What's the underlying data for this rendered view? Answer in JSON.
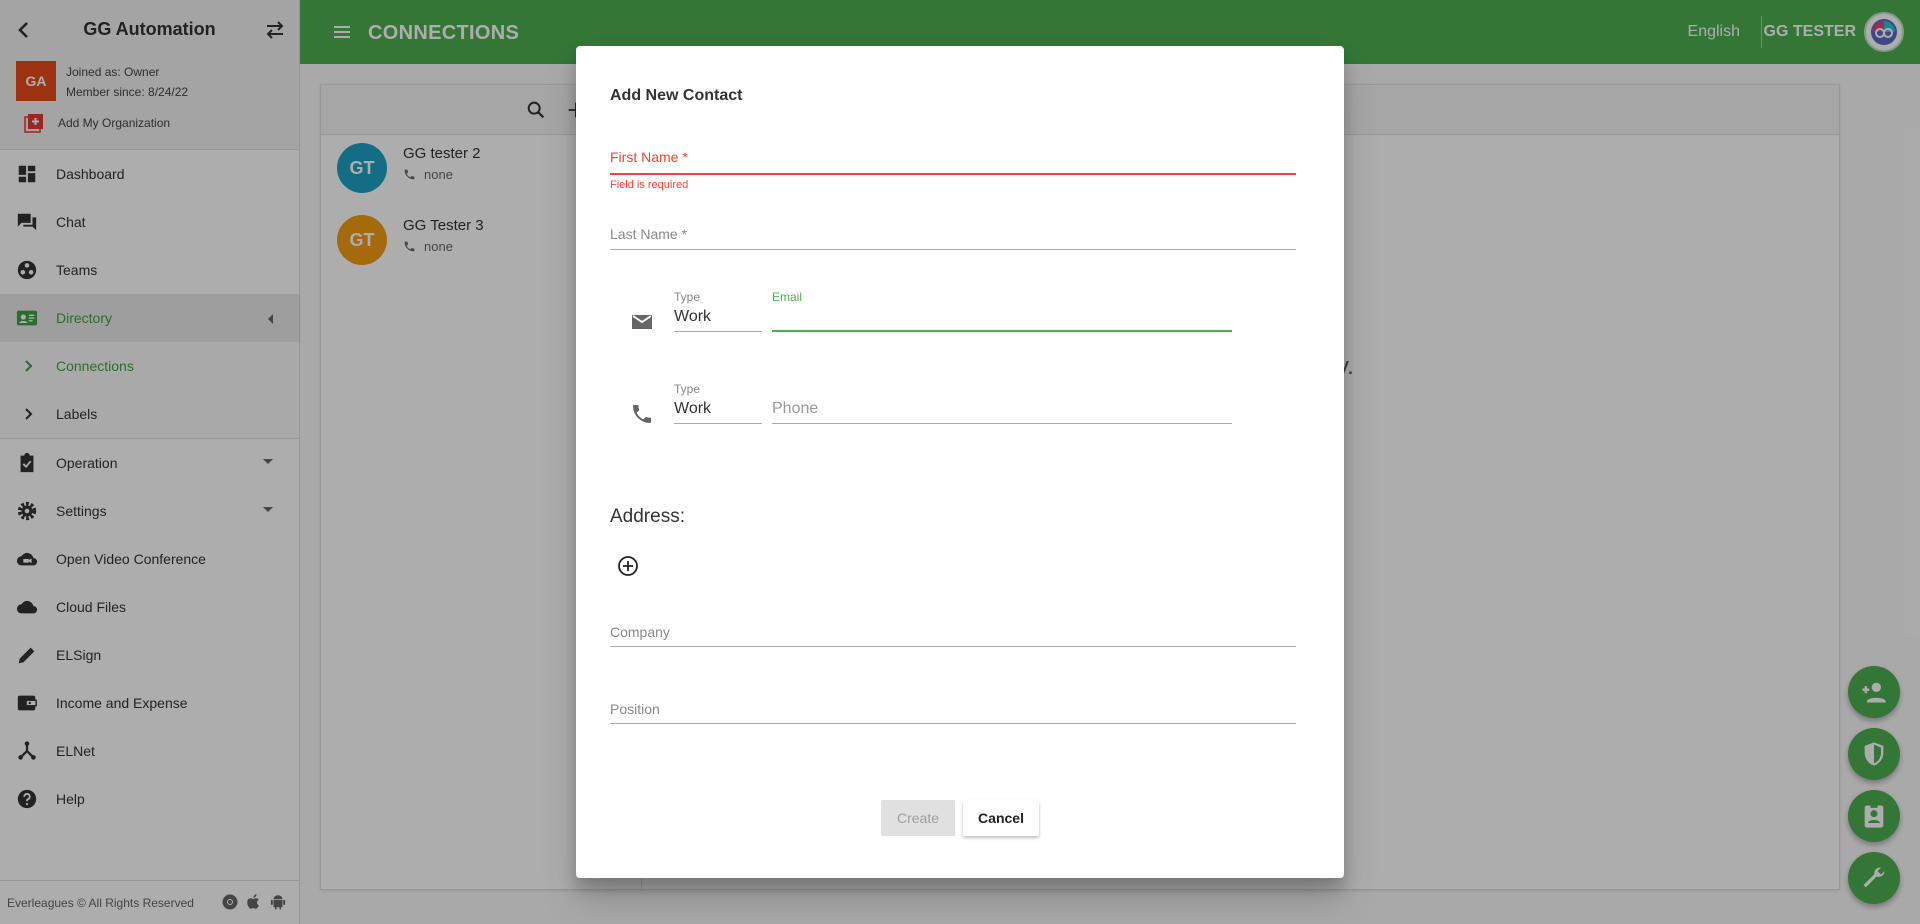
{
  "sidebar": {
    "org_name": "GG Automation",
    "avatar_initials": "GA",
    "joined": "Joined as: Owner",
    "member_since": "Member since: 8/24/22",
    "add_org": "Add My Organization",
    "items": {
      "dashboard": "Dashboard",
      "chat": "Chat",
      "teams": "Teams",
      "directory": "Directory",
      "connections": "Connections",
      "labels": "Labels",
      "operation": "Operation",
      "settings": "Settings",
      "video": "Open Video Conference",
      "cloud": "Cloud Files",
      "elsign": "ELSign",
      "income": "Income and Expense",
      "elnet": "ELNet",
      "help": "Help"
    },
    "footer": "Everleagues © All Rights Reserved"
  },
  "topbar": {
    "title": "CONNECTIONS",
    "language": "English",
    "user": "GG TESTER"
  },
  "contacts": [
    {
      "initials": "GT",
      "name": "GG tester 2",
      "phone": "none",
      "color": "#1ca3c4"
    },
    {
      "initials": "GT",
      "name": "GG Tester 3",
      "phone": "none",
      "color": "#f39c12"
    }
  ],
  "main": {
    "empty_message": "business cards away."
  },
  "dialog": {
    "title": "Add New Contact",
    "first_name_label": "First Name *",
    "first_name_error": "Field is required",
    "last_name_label": "Last Name *",
    "email_type_label": "Type",
    "email_type_value": "Work",
    "email_label": "Email",
    "phone_type_label": "Type",
    "phone_type_value": "Work",
    "phone_placeholder": "Phone",
    "address_label": "Address:",
    "company_label": "Company",
    "position_label": "Position",
    "create_label": "Create",
    "cancel_label": "Cancel"
  },
  "colors": {
    "brand": "#4caf50",
    "error": "#f44336"
  }
}
